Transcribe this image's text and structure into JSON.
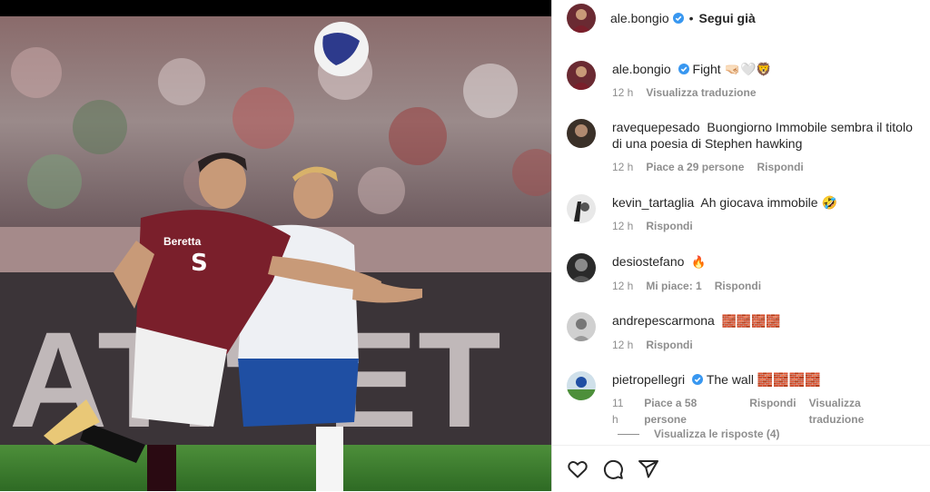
{
  "header": {
    "username": "ale.bongio",
    "separator": "•",
    "follow_label": "Segui già"
  },
  "caption": {
    "username": "ale.bongio",
    "text": "Fight 🤜🏻🤍🦁",
    "time": "12 h",
    "translate_label": "Visualizza traduzione"
  },
  "comments": [
    {
      "username": "ravequepesado",
      "text": "Buongiorno Immobile sembra il titolo di una poesia di Stephen hawking",
      "time": "12 h",
      "likes": "Piace a 29 persone",
      "reply_label": "Rispondi"
    },
    {
      "username": "kevin_tartaglia",
      "text": "Ah giocava immobile 🤣",
      "time": "12 h",
      "reply_label": "Rispondi"
    },
    {
      "username": "desiostefano",
      "text": "🔥",
      "time": "12 h",
      "likes": "Mi piace: 1",
      "reply_label": "Rispondi"
    },
    {
      "username": "andrepescarmona",
      "text": "🧱🧱🧱🧱",
      "time": "12 h",
      "reply_label": "Rispondi"
    },
    {
      "username": "pietropellegri",
      "text": "The wall 🧱🧱🧱🧱",
      "time": "11 h",
      "likes": "Piace a 58 persone",
      "reply_label": "Rispondi",
      "translate_label": "Visualizza traduzione"
    }
  ],
  "view_replies_label": "Visualizza le risposte (4)",
  "icons": {
    "like": "heart-icon",
    "comment": "comment-icon",
    "share": "send-icon"
  },
  "colors": {
    "verified": "#3897f0",
    "secondary_text": "#8e8e8e",
    "torino_maroon": "#7a1f2b",
    "lazio_blue": "#1f4fa3"
  }
}
